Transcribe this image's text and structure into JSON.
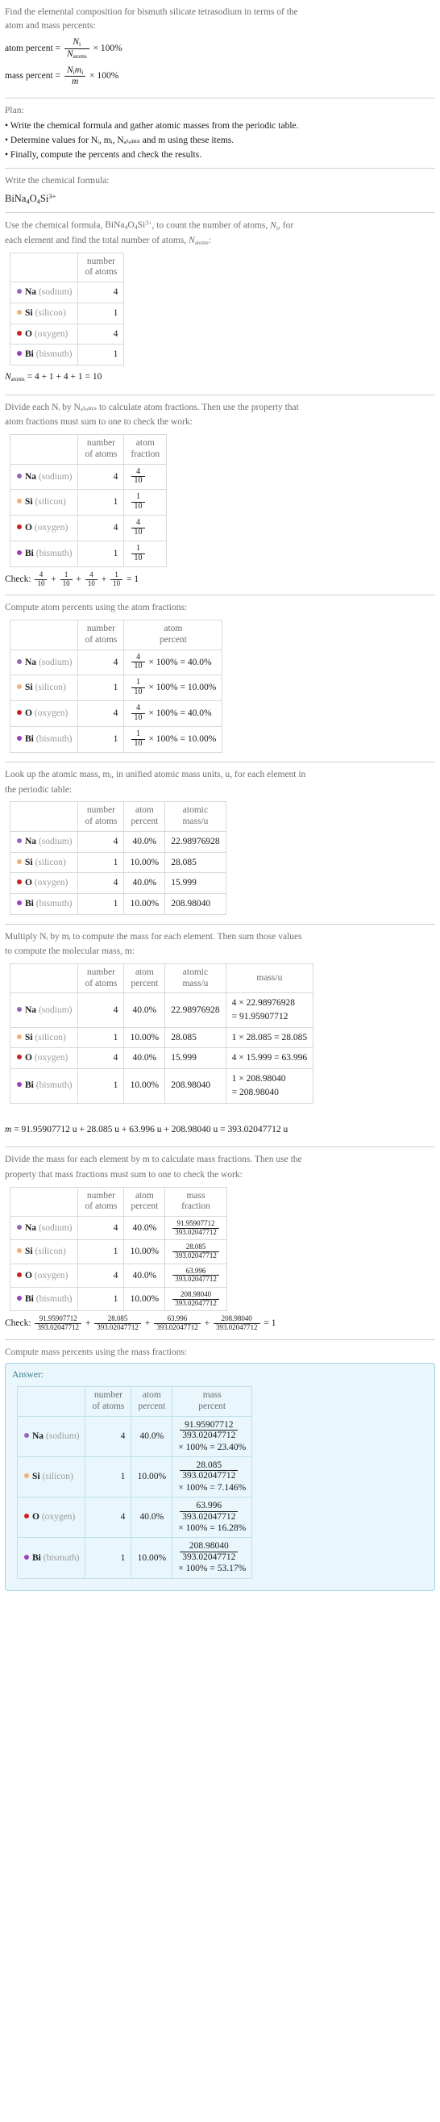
{
  "header": {
    "question_line1": "Find the elemental composition for bismuth silicate tetrasodium in terms of the",
    "question_line2": "atom and mass percents:",
    "atom_percent_label": "atom percent =",
    "atom_percent_num": "N",
    "atom_percent_num_sub": "i",
    "atom_percent_den": "N",
    "atom_percent_den_sub": "atoms",
    "times100": "× 100%",
    "mass_percent_label": "mass percent =",
    "mass_percent_num": "N",
    "mass_percent_num_sub": "i",
    "mass_percent_num2": "m",
    "mass_percent_num2_sub": "i",
    "mass_percent_den": "m"
  },
  "plan": {
    "label": "Plan:",
    "items": [
      "• Write the chemical formula and gather atomic masses from the periodic table.",
      "• Determine values for Nᵢ, mᵢ, Nₐₜₒₘₛ and m using these items.",
      "• Finally, compute the percents and check the results."
    ]
  },
  "formula_section": {
    "prompt": "Write the chemical formula:",
    "formula_plain": "BiNa4O4Si3+"
  },
  "count_section": {
    "prompt_pre": "Use the chemical formula, ",
    "prompt_formula": "BiNa4O4Si3+",
    "prompt_mid": ", to count the number of atoms, ",
    "prompt_ni": "N",
    "prompt_ni_sub": "i",
    "prompt_post": ", for",
    "prompt_line2": "each element and find the total number of atoms, ",
    "prompt_natoms": "N",
    "prompt_natoms_sub": "atoms",
    "prompt_colon": ":",
    "headers": [
      "",
      "number of atoms"
    ],
    "header_number": "number",
    "header_of_atoms": "of atoms",
    "total_line": "N",
    "total_sub": "atoms",
    "total_expr": "= 4 + 1 + 4 + 1 = 10"
  },
  "elements": [
    {
      "symbol": "Na",
      "name": "(sodium)",
      "color": "#9467bd",
      "count": "4",
      "atom_fraction_num": "4",
      "atom_fraction_den": "10",
      "atom_percent": "40.0%",
      "atomic_mass": "22.98976928",
      "mass_expr_line1": "4 × 22.98976928",
      "mass_expr_line2": "= 91.95907712",
      "mass_value": "91.95907712",
      "mass_fraction_num": "91.95907712",
      "mass_fraction_den": "393.02047712",
      "mass_percent_tail": "× 100% = 23.40%"
    },
    {
      "symbol": "Si",
      "name": "(silicon)",
      "color": "#f0b27a",
      "count": "1",
      "atom_fraction_num": "1",
      "atom_fraction_den": "10",
      "atom_percent": "10.00%",
      "atomic_mass": "28.085",
      "mass_expr_line1": "1 × 28.085 = 28.085",
      "mass_expr_line2": "",
      "mass_value": "28.085",
      "mass_fraction_num": "28.085",
      "mass_fraction_den": "393.02047712",
      "mass_percent_tail": "× 100% = 7.146%"
    },
    {
      "symbol": "O",
      "name": "(oxygen)",
      "color": "#cc2222",
      "count": "4",
      "atom_fraction_num": "4",
      "atom_fraction_den": "10",
      "atom_percent": "40.0%",
      "atomic_mass": "15.999",
      "mass_expr_line1": "4 × 15.999 = 63.996",
      "mass_expr_line2": "",
      "mass_value": "63.996",
      "mass_fraction_num": "63.996",
      "mass_fraction_den": "393.02047712",
      "mass_percent_tail": "× 100% = 16.28%"
    },
    {
      "symbol": "Bi",
      "name": "(bismuth)",
      "color": "#9b3fbd",
      "count": "1",
      "atom_fraction_num": "1",
      "atom_fraction_den": "10",
      "atom_percent": "10.00%",
      "atomic_mass": "208.98040",
      "mass_expr_line1": "1 × 208.98040",
      "mass_expr_line2": "= 208.98040",
      "mass_value": "208.98040",
      "mass_fraction_num": "208.98040",
      "mass_fraction_den": "393.02047712",
      "mass_percent_tail": "× 100% = 53.17%"
    }
  ],
  "atom_fraction_section": {
    "prompt_line1": "Divide each Nᵢ by Nₐₜₒₘₛ to calculate atom fractions. Then use the property that",
    "prompt_line2": "atom fractions must sum to one to check the work:",
    "header_number": "number",
    "header_of_atoms": "of atoms",
    "header_atom": "atom",
    "header_fraction": "fraction",
    "check_label": "Check:",
    "check_result": "= 1"
  },
  "atom_percent_section": {
    "prompt": "Compute atom percents using the atom fractions:",
    "header_number": "number",
    "header_of_atoms": "of atoms",
    "header_atom": "atom",
    "header_percent": "percent",
    "times_100_eq": "× 100% ="
  },
  "atomic_mass_section": {
    "prompt_line1": "Look up the atomic mass, mᵢ, in unified atomic mass units, u, for each element in",
    "prompt_line2": "the periodic table:",
    "header_number": "number",
    "header_of_atoms": "of atoms",
    "header_atom": "atom",
    "header_percent": "percent",
    "header_atomic": "atomic",
    "header_massu": "mass/u"
  },
  "mass_section": {
    "prompt_line1": "Multiply Nᵢ by mᵢ to compute the mass for each element. Then sum those values",
    "prompt_line2": "to compute the molecular mass, m:",
    "header_number": "number",
    "header_of_atoms": "of atoms",
    "header_atom": "atom",
    "header_percent": "percent",
    "header_atomic": "atomic",
    "header_massu": "mass/u",
    "header_mass_u": "mass/u",
    "total_prefix": "m",
    "total_expr": "= 91.95907712 u + 28.085 u + 63.996 u + 208.98040 u = 393.02047712 u"
  },
  "mass_fraction_section": {
    "prompt_line1": "Divide the mass for each element by m to calculate mass fractions. Then use the",
    "prompt_line2": "property that mass fractions must sum to one to check the work:",
    "header_number": "number",
    "header_of_atoms": "of atoms",
    "header_atom": "atom",
    "header_percent": "percent",
    "header_mass": "mass",
    "header_fraction": "fraction",
    "check_label": "Check:",
    "check_result": "= 1"
  },
  "answer_section": {
    "prompt": "Compute mass percents using the mass fractions:",
    "answer_label": "Answer:",
    "header_number": "number",
    "header_of_atoms": "of atoms",
    "header_atom": "atom",
    "header_percent": "percent",
    "header_mass": "mass",
    "header_percent2": "percent"
  },
  "colors": {
    "answer_bg": "#e9f7fd",
    "answer_border": "#9fd3e3",
    "table_border": "#d8d8d8",
    "muted_text": "#6e6e6e"
  }
}
